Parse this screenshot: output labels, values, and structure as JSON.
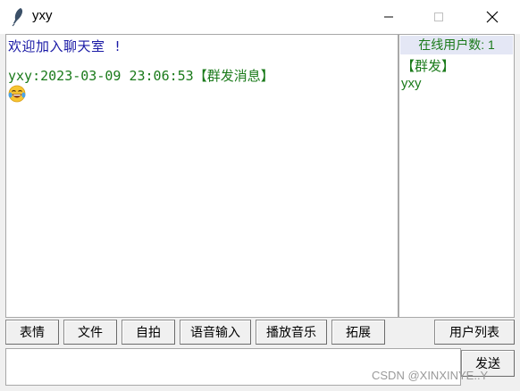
{
  "window": {
    "title": "yxy",
    "controls": [
      "minimize-icon",
      "maximize-icon",
      "close-icon"
    ]
  },
  "chat": {
    "welcome": "欢迎加入聊天室 !",
    "messages": [
      {
        "header": "yxy:2023-03-09 23:06:53【群发消息】",
        "content_icon": "laughing-tears-emoji-icon"
      }
    ]
  },
  "users": {
    "online_count": "在线用户数: 1",
    "items": [
      "【群发】",
      "yxy"
    ]
  },
  "toolbar": {
    "emoji_label": "表情",
    "file_label": "文件",
    "selfie_label": "自拍",
    "voice_label": "语音输入",
    "music_label": "播放音乐",
    "expand_label": "拓展",
    "userlist_label": "用户列表"
  },
  "input": {
    "value": "",
    "send_label": "发送"
  },
  "watermark": "CSDN @XINXINYE..Y",
  "colors": {
    "green_text": "#1a7a1a",
    "blue_text": "#1a1aa6",
    "highlight": "#e4e7f5"
  }
}
